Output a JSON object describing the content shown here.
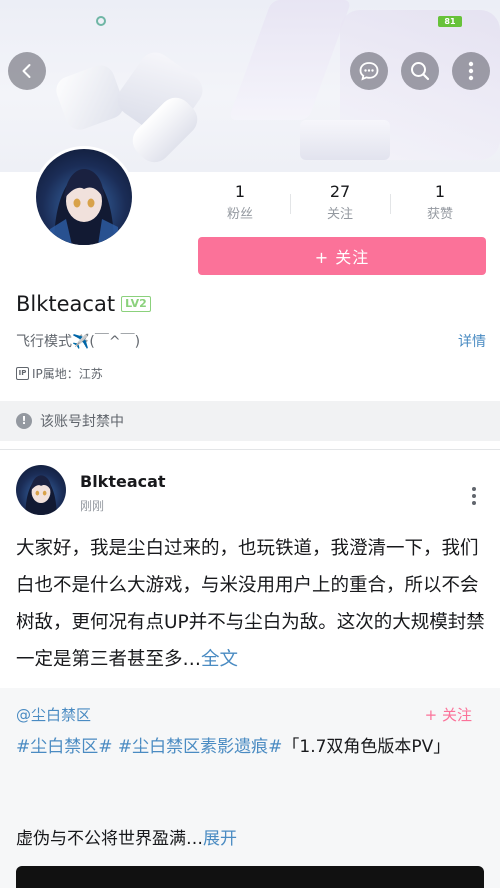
{
  "status_bar": {
    "battery": "81"
  },
  "header": {
    "back_icon": "chevron-left-icon",
    "message_icon": "chat-bubble-icon",
    "search_icon": "search-icon",
    "more_icon": "more-vertical-icon"
  },
  "profile": {
    "stats": [
      {
        "value": "1",
        "label": "粉丝"
      },
      {
        "value": "27",
        "label": "关注"
      },
      {
        "value": "1",
        "label": "获赞"
      }
    ],
    "follow_label": "+ 关注",
    "username": "Blkteacat",
    "level": "LV2",
    "bio": "飞行模式✈️(￣^￣)",
    "detail_label": "详情",
    "ip_label": "IP属地：江苏",
    "ban_notice": "该账号封禁中"
  },
  "post": {
    "author": "Blkteacat",
    "time": "刚刚",
    "text": "大家好，我是尘白过来的，也玩铁道，我澄清一下，我们白也不是什么大游戏，与米没用用户上的重合，所以不会树敌，更何况有点UP并不与尘白为敌。这次的大规模封禁一定是第三者甚至多…",
    "full_text_label": "全文",
    "quote": {
      "source": "@尘白禁区",
      "follow_label": "+ 关注",
      "tags": "#尘白禁区# #尘白禁区素影遗痕#",
      "title": "「1.7双角色版本PV」",
      "subtitle": "虚伪与不公将世界盈满…",
      "expand_label": "展开"
    }
  },
  "colors": {
    "accent_pink": "#fb7299",
    "link_blue": "#4a8bc2",
    "level_green": "#8bd17c"
  }
}
